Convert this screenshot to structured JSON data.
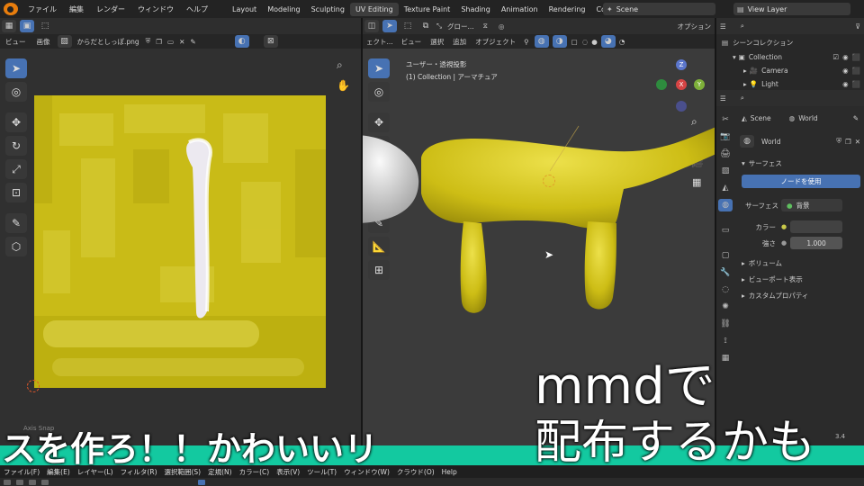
{
  "topbar": {
    "menus": [
      "ファイル",
      "編集",
      "レンダー",
      "ウィンドウ",
      "ヘルプ"
    ],
    "workspaces": [
      "Layout",
      "Modeling",
      "Sculpting",
      "UV Editing",
      "Texture Paint",
      "Shading",
      "Animation",
      "Rendering",
      "Composi"
    ],
    "active_workspace": "UV Editing",
    "scene": "Scene",
    "view_layer": "View Layer"
  },
  "image_editor": {
    "menu_view": "ビュー",
    "menu_image": "画像",
    "image_name": "からだとしっぽ.png",
    "status_left": "Axis Snap"
  },
  "viewport": {
    "mode_label": "ェクト...",
    "menus": [
      "ビュー",
      "選択",
      "追加",
      "オブジェクト"
    ],
    "transform_label": "グロー...",
    "options_label": "オプション",
    "view_name": "ユーザー・透視投影",
    "collection_info": "(1) Collection | アーマチュア",
    "gizmo_axes": [
      "Z",
      "Y",
      "X"
    ]
  },
  "outliner": {
    "title": "シーンコレクション",
    "items": [
      "Collection",
      "Camera",
      "Light"
    ]
  },
  "properties": {
    "breadcrumb_scene": "Scene",
    "breadcrumb_world": "World",
    "world_name": "World",
    "section_surface": "サーフェス",
    "use_nodes_button": "ノードを使用",
    "surface_label": "サーフェス",
    "surface_value": "背景",
    "color_label": "カラー",
    "strength_label": "強さ",
    "strength_value": "1.000",
    "section_volume": "ボリューム",
    "section_viewport_display": "ビューポート表示",
    "section_custom_props": "カスタムプロパティ"
  },
  "overlay_menu": [
    "ファイル(F)",
    "編集(E)",
    "レイヤー(L)",
    "フィルタ(R)",
    "選択範囲(S)",
    "定規(N)",
    "カラー(C)",
    "表示(V)",
    "ツール(T)",
    "ウィンドウ(W)",
    "クラウド(O)",
    "Help"
  ],
  "version": "3.4",
  "subtitles": {
    "line_left": "スを作ろ！！かわいいリ",
    "line_right_1": "mmdで",
    "line_right_2": "配布するかも"
  },
  "colors": {
    "accent_blue": "#4772b3",
    "texture_yellow": "#c9bb17",
    "mesh_yellow": "#d8c81a",
    "subtitle_band": "#13c9a0"
  }
}
